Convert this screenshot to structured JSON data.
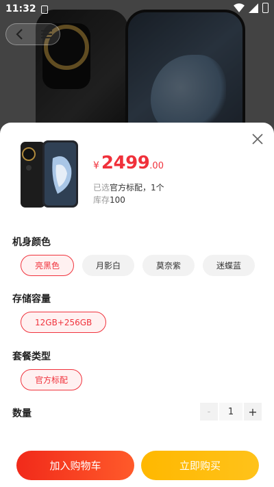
{
  "status_bar": {
    "time": "11:32"
  },
  "product": {
    "currency": "¥",
    "price_integer": "2499",
    "price_decimal": ".00",
    "selected_label": "已选",
    "selected_value": "官方标配，1个",
    "stock_label": "库存",
    "stock_value": "100"
  },
  "sections": {
    "color": {
      "title": "机身颜色",
      "options": [
        "亮黑色",
        "月影白",
        "莫奈紫",
        "迷蝶蓝"
      ],
      "selected": "亮黑色"
    },
    "storage": {
      "title": "存储容量",
      "options": [
        "12GB+256GB"
      ],
      "selected": "12GB+256GB"
    },
    "package": {
      "title": "套餐类型",
      "options": [
        "官方标配"
      ],
      "selected": "官方标配"
    },
    "quantity": {
      "title": "数量",
      "value": "1",
      "minus": "-",
      "plus": "+"
    }
  },
  "actions": {
    "add_to_cart": "加入购物车",
    "buy_now": "立即购买"
  },
  "colors": {
    "accent": "#f0313b",
    "cart_button": "#f12a1a",
    "buy_button": "#ffb800"
  }
}
